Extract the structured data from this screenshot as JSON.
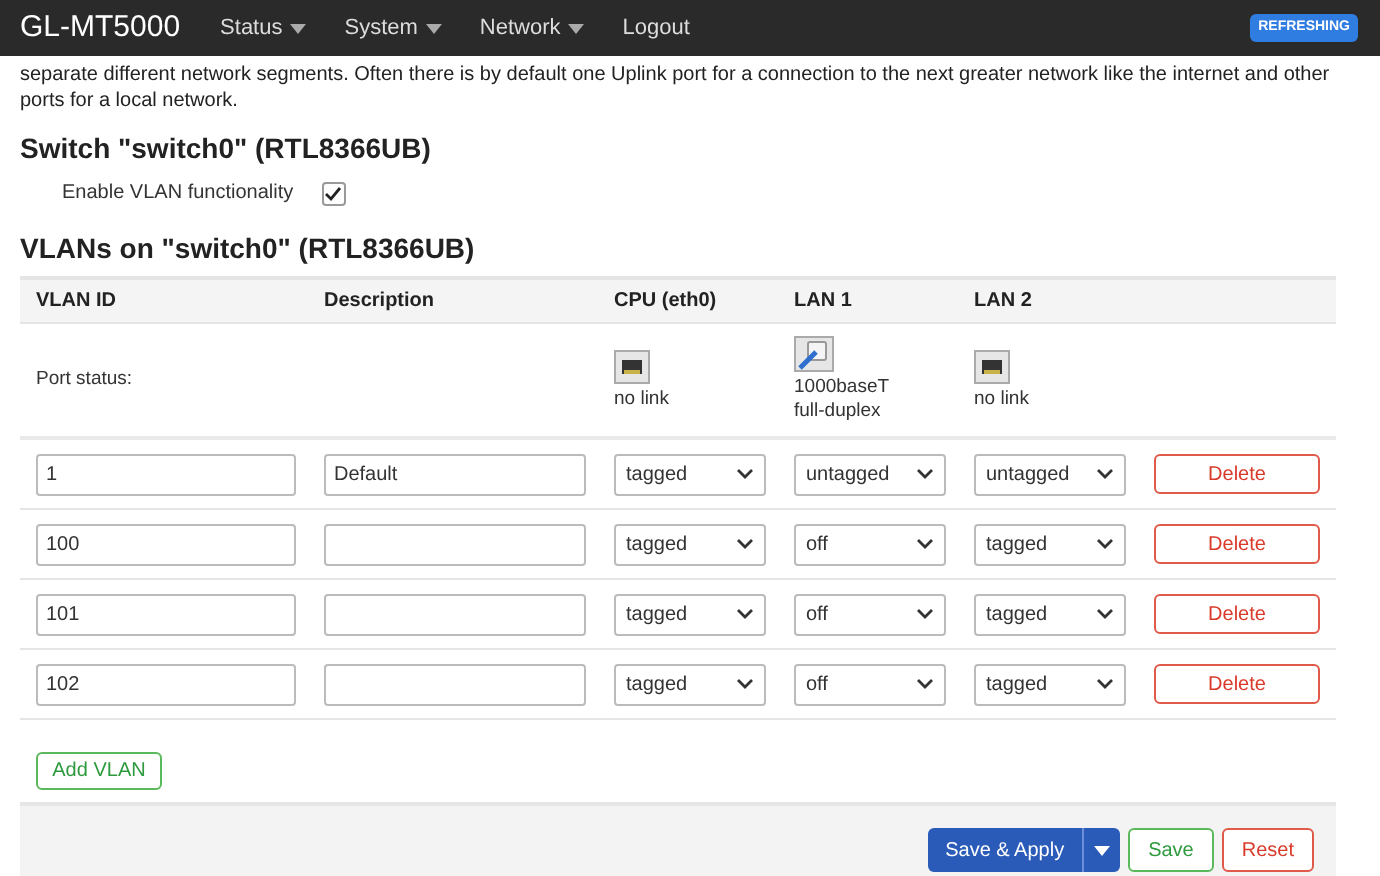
{
  "navbar": {
    "brand": "GL-MT5000",
    "menu": [
      {
        "label": "Status",
        "dropdown": true
      },
      {
        "label": "System",
        "dropdown": true
      },
      {
        "label": "Network",
        "dropdown": true
      },
      {
        "label": "Logout",
        "dropdown": false
      }
    ],
    "badge": "REFRESHING"
  },
  "intro": "separate different network segments. Often there is by default one Uplink port for a connection to the next greater network like the internet and other ports for a local network.",
  "switch_section": {
    "title": "Switch \"switch0\" (RTL8366UB)",
    "option": {
      "label": "Enable VLAN functionality",
      "checked": true
    }
  },
  "vlan_table": {
    "title": "VLANs on \"switch0\" (RTL8366UB)",
    "columns": [
      "VLAN ID",
      "Description",
      "CPU (eth0)",
      "LAN 1",
      "LAN 2"
    ],
    "port_status": {
      "label": "Port status:",
      "ports": [
        {
          "linked": false,
          "lines": [
            "no link"
          ]
        },
        {
          "linked": true,
          "lines": [
            "1000baseT",
            "full-duplex"
          ]
        },
        {
          "linked": false,
          "lines": [
            "no link"
          ]
        }
      ]
    },
    "rows": [
      {
        "vlan_id": "1",
        "description": "Default",
        "ports": [
          "tagged",
          "untagged",
          "untagged"
        ],
        "delete": "Delete"
      },
      {
        "vlan_id": "100",
        "ports": [
          "tagged",
          "off",
          "tagged"
        ],
        "delete": "Delete"
      },
      {
        "vlan_id": "101",
        "ports": [
          "tagged",
          "off",
          "tagged"
        ],
        "delete": "Delete"
      },
      {
        "vlan_id": "102",
        "ports": [
          "tagged",
          "off",
          "tagged"
        ],
        "delete": "Delete"
      }
    ],
    "add_button": "Add VLAN"
  },
  "footer": {
    "save_apply": "Save & Apply",
    "save": "Save",
    "reset": "Reset"
  }
}
